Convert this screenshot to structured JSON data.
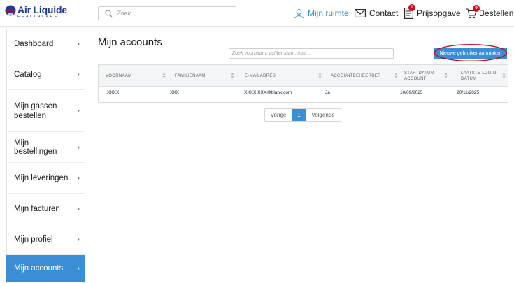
{
  "header": {
    "logo_brand": "Air Liquide",
    "logo_sub": "HEALTHCARE",
    "search_placeholder": "Zoek",
    "nav": {
      "mijn_ruimte": "Mijn ruimte",
      "contact": "Contact",
      "prijsopgave": "Prijsopgave",
      "prijsopgave_badge": "0",
      "bestellen": "Bestellen",
      "bestellen_badge": "0"
    }
  },
  "sidebar": {
    "items": [
      {
        "label": "Dashboard"
      },
      {
        "label": "Catalog"
      },
      {
        "label": "Mijn gassen bestellen"
      },
      {
        "label": "Mijn bestellingen"
      },
      {
        "label": "Mijn leveringen"
      },
      {
        "label": "Mijn facturen"
      },
      {
        "label": "Mijn profiel"
      },
      {
        "label": "Mijn accounts"
      }
    ],
    "active_index": 7
  },
  "main": {
    "title": "Mijn accounts",
    "table_search_placeholder": "Zoek voornaam, achternaam, mail...",
    "new_user_button": "Nieuwe gebruiker aanmaken",
    "columns": [
      "VOORNAAM",
      "FAMILIENAAM",
      "E-MAILADRES",
      "ACCOUNTBEHEERDER",
      "STARTDATUM ACCOUNT",
      "LAATSTE LOGIN DATUM"
    ],
    "rows": [
      [
        "XXXX",
        "XXX",
        "XXXX.XXX@blank.com",
        "Ja",
        "10/09/2025",
        "20/11/2025"
      ]
    ],
    "pager": {
      "prev": "Vorige",
      "current": "1",
      "next": "Volgende"
    }
  },
  "colors": {
    "accent": "#3b8ed3",
    "brand": "#1f3a93",
    "badge": "#d0021b",
    "highlight_ring": "#d0021b"
  }
}
